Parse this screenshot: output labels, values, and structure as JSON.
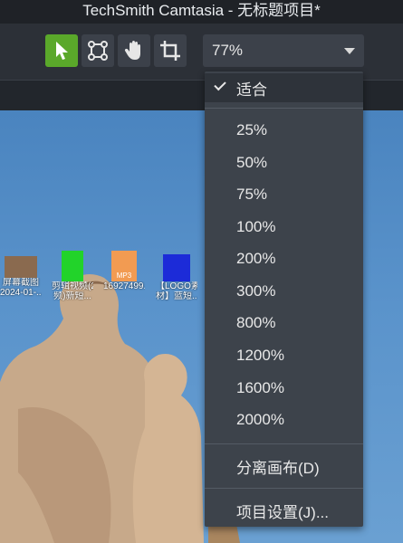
{
  "window": {
    "title": "TechSmith Camtasia - 无标题项目*"
  },
  "toolbar": {
    "tools": [
      {
        "name": "select",
        "icon": "arrow-pointer-icon",
        "active": true
      },
      {
        "name": "edit-points",
        "icon": "vector-points-icon",
        "active": false
      },
      {
        "name": "pan",
        "icon": "hand-icon",
        "active": false
      },
      {
        "name": "crop",
        "icon": "crop-icon",
        "active": false
      }
    ],
    "zoom": {
      "value": "77%",
      "icon": "chevron-down-icon"
    }
  },
  "desktop_icons": [
    {
      "label1": "屏幕截图",
      "label2": "2024-01-...",
      "color": "#8a6a4f"
    },
    {
      "label1": "剪辑视频(2",
      "label2": "频)新短...",
      "color": "#22d32a"
    },
    {
      "label1": "MP3",
      "label2": "16927499...",
      "color": "#f29b52"
    },
    {
      "label1": "【LOGO素",
      "label2": "材】蓝短...",
      "color": "#1c2bd8"
    }
  ],
  "zoom_menu": {
    "fit_label": "适合",
    "fit_checked": true,
    "levels": [
      "25%",
      "50%",
      "75%",
      "100%",
      "200%",
      "300%",
      "800%",
      "1200%",
      "1600%",
      "2000%"
    ],
    "detach_label": "分离画布(D)",
    "settings_label": "项目设置(J)..."
  }
}
